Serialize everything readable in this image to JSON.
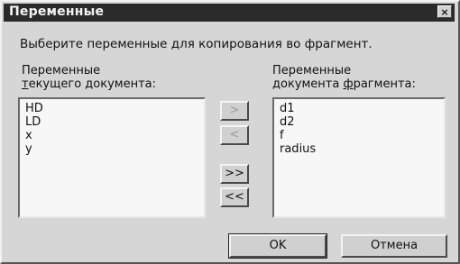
{
  "window": {
    "title": "Переменные",
    "close_glyph": "×"
  },
  "instruction": "Выберите переменные для копирования во фрагмент.",
  "left_panel": {
    "label_line1": "Переменные",
    "label_line2_mnemonic": "т",
    "label_line2_rest": "екущего документа:",
    "items": [
      "HD",
      "LD",
      "x",
      "y"
    ]
  },
  "right_panel": {
    "label_line1": "Переменные",
    "label_line2_pre": "документа ",
    "label_line2_mnemonic": "ф",
    "label_line2_post": "рагмента:",
    "items": [
      "d1",
      "d2",
      "f",
      "radius"
    ]
  },
  "transfer_buttons": {
    "move_right": ">",
    "move_left": "<",
    "move_all_right": ">>",
    "move_all_left": "<<"
  },
  "footer": {
    "ok_label": "OK",
    "cancel_label": "Отмена"
  }
}
